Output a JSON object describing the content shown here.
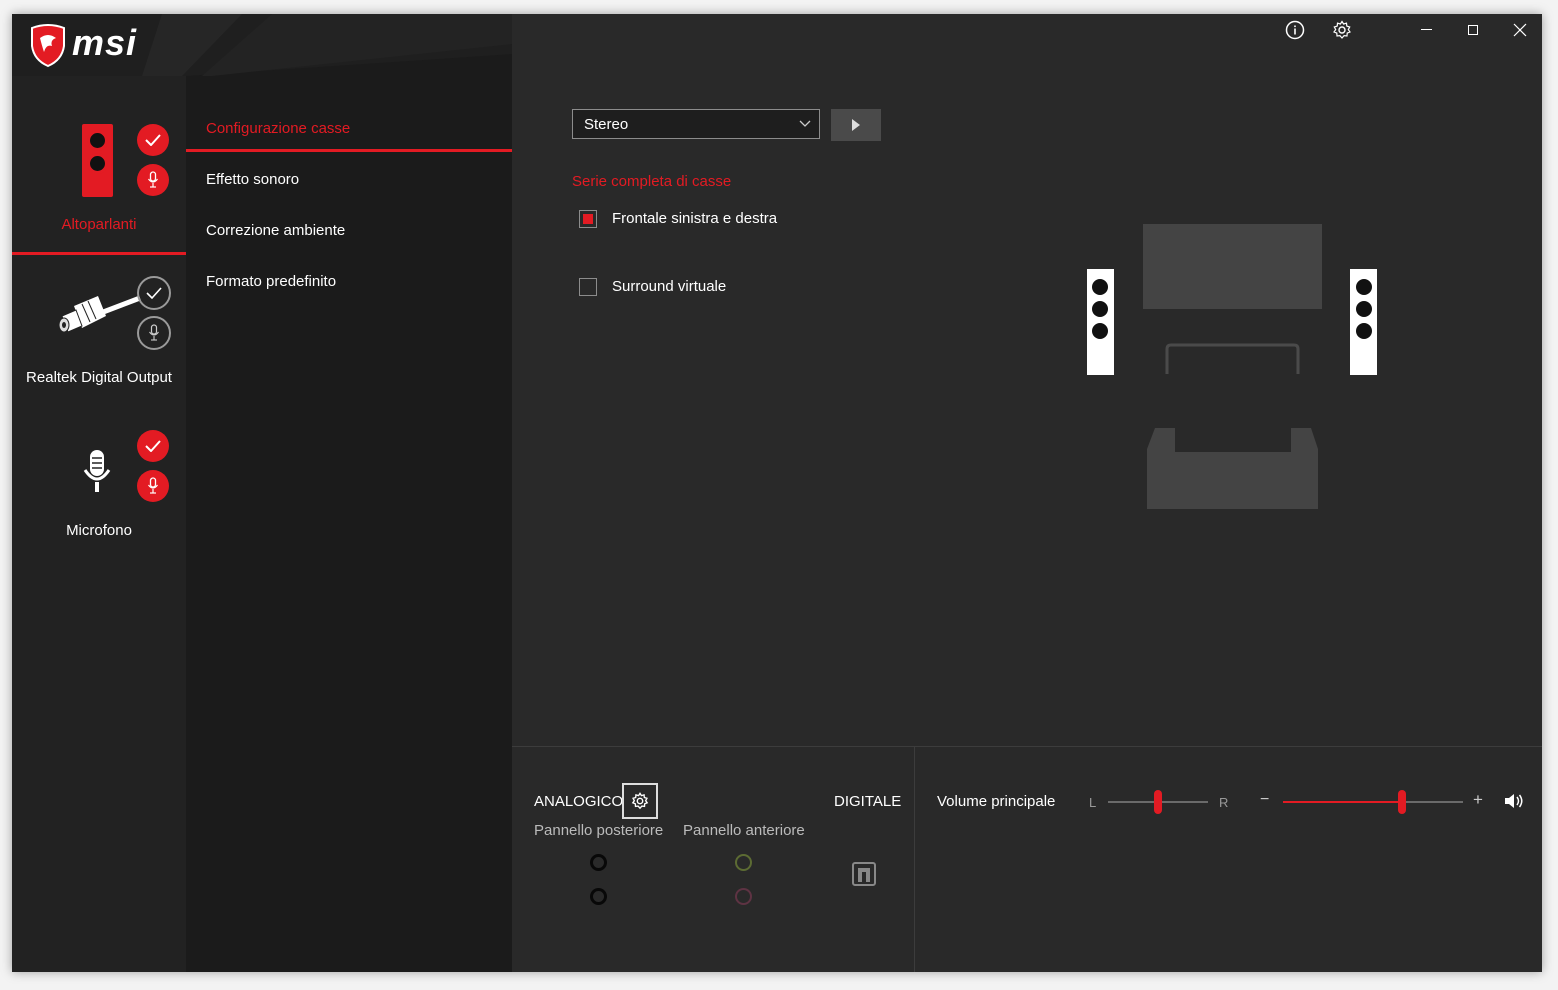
{
  "brand": {
    "logo_text": "msi"
  },
  "window_controls": {
    "info_icon": "info-icon",
    "settings_icon": "gear-icon",
    "minimize_icon": "minimize-icon",
    "maximize_icon": "maximize-icon",
    "close_icon": "close-icon"
  },
  "devices": [
    {
      "label": "Altoparlanti",
      "active": true,
      "default_device": true,
      "default_comm": true
    },
    {
      "label": "Realtek Digital Output",
      "active": false,
      "default_device": false,
      "default_comm": false
    },
    {
      "label": "Microfono",
      "active": false,
      "default_device": true,
      "default_comm": true
    }
  ],
  "nav": [
    {
      "label": "Configurazione casse",
      "active": true
    },
    {
      "label": "Effetto sonoro",
      "active": false
    },
    {
      "label": "Correzione ambiente",
      "active": false
    },
    {
      "label": "Formato predefinito",
      "active": false
    }
  ],
  "speaker_config": {
    "selected": "Stereo",
    "section_title": "Serie completa di casse",
    "options": [
      {
        "label": "Frontale sinistra e destra",
        "checked": true
      },
      {
        "label": "Surround virtuale",
        "checked": false
      }
    ]
  },
  "bottom": {
    "analog_label": "ANALOGICO",
    "digital_label": "DIGITALE",
    "rear_panel_label": "Pannello posteriore",
    "front_panel_label": "Pannello anteriore",
    "volume_label": "Volume principale",
    "balance_left": "L",
    "balance_right": "R",
    "volume_minus": "−",
    "volume_plus": "+",
    "balance_value": 0.5,
    "volume_value": 0.66
  },
  "colors": {
    "accent": "#e31b23",
    "bg": "#292929",
    "sidebar": "#222222",
    "nav": "#1b1b1b"
  }
}
